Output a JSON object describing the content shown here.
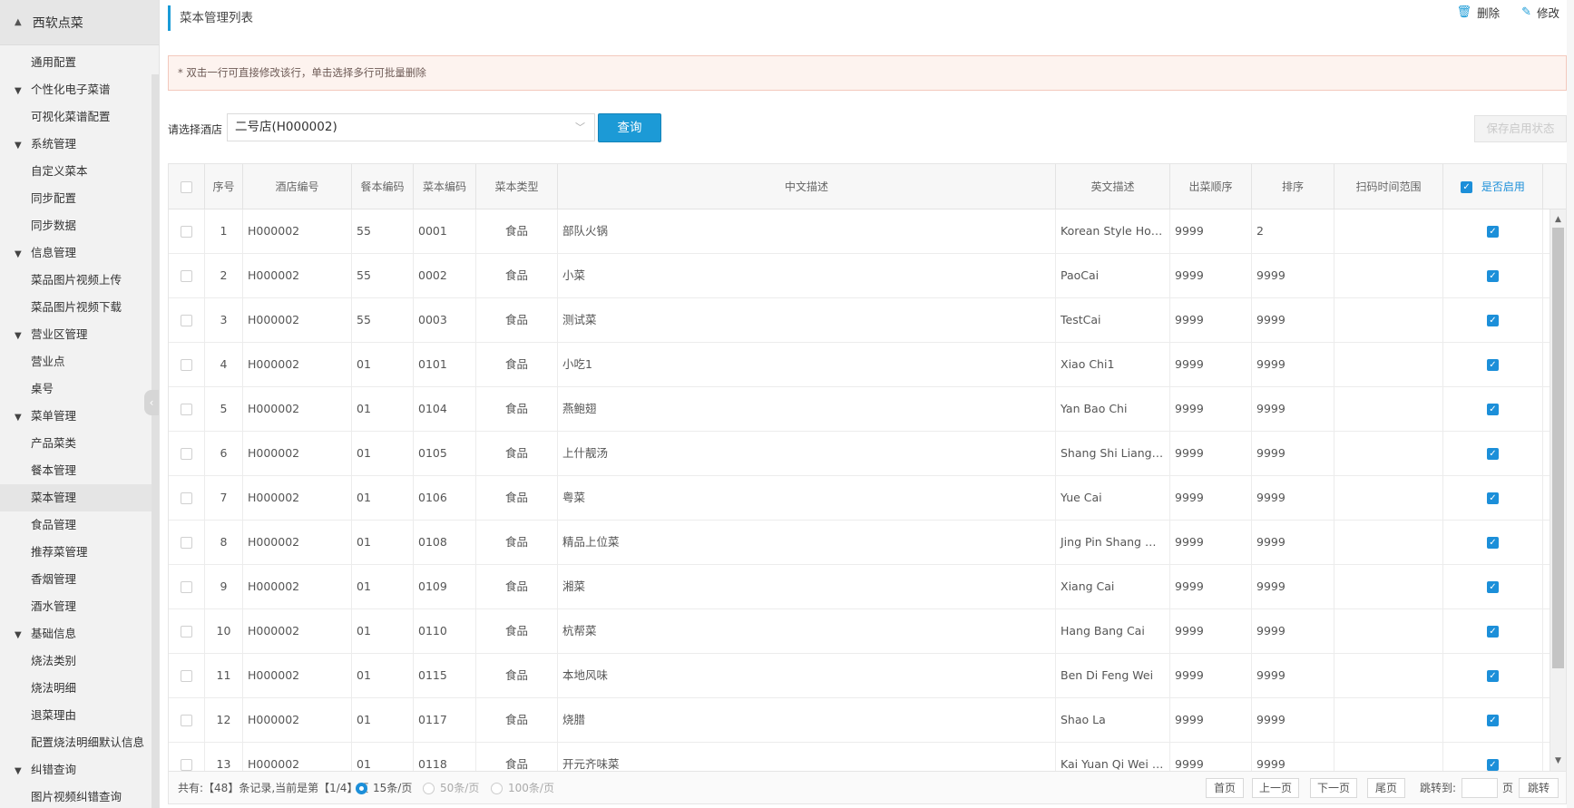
{
  "app": {
    "title": "西软点菜"
  },
  "sidebar": {
    "items": [
      {
        "label": "通用配置",
        "type": "sub"
      },
      {
        "label": "个性化电子菜谱",
        "type": "grp"
      },
      {
        "label": "可视化菜谱配置",
        "type": "sub"
      },
      {
        "label": "系统管理",
        "type": "grp"
      },
      {
        "label": "自定义菜本",
        "type": "sub"
      },
      {
        "label": "同步配置",
        "type": "sub"
      },
      {
        "label": "同步数据",
        "type": "sub"
      },
      {
        "label": "信息管理",
        "type": "grp"
      },
      {
        "label": "菜品图片视频上传",
        "type": "sub"
      },
      {
        "label": "菜品图片视频下载",
        "type": "sub"
      },
      {
        "label": "营业区管理",
        "type": "grp"
      },
      {
        "label": "营业点",
        "type": "sub"
      },
      {
        "label": "桌号",
        "type": "sub"
      },
      {
        "label": "菜单管理",
        "type": "grp"
      },
      {
        "label": "产品菜类",
        "type": "sub"
      },
      {
        "label": "餐本管理",
        "type": "sub"
      },
      {
        "label": "菜本管理",
        "type": "sub",
        "active": true
      },
      {
        "label": "食品管理",
        "type": "sub"
      },
      {
        "label": "推荐菜管理",
        "type": "sub"
      },
      {
        "label": "香烟管理",
        "type": "sub"
      },
      {
        "label": "酒水管理",
        "type": "sub"
      },
      {
        "label": "基础信息",
        "type": "grp"
      },
      {
        "label": "烧法类别",
        "type": "sub"
      },
      {
        "label": "烧法明细",
        "type": "sub"
      },
      {
        "label": "退菜理由",
        "type": "sub"
      },
      {
        "label": "配置烧法明细默认信息",
        "type": "sub"
      },
      {
        "label": "纠错查询",
        "type": "grp"
      },
      {
        "label": "图片视频纠错查询",
        "type": "sub"
      }
    ]
  },
  "header": {
    "title": "菜本管理列表",
    "delete_label": "删除",
    "edit_label": "修改"
  },
  "notice": "* 双击一行可直接修改该行，单击选择多行可批量删除",
  "filter": {
    "label": "请选择酒店",
    "selected": "二号店(H000002)",
    "query_label": "查询",
    "save_label": "保存启用状态"
  },
  "table": {
    "columns": [
      "序号",
      "酒店编号",
      "餐本编码",
      "菜本编码",
      "菜本类型",
      "中文描述",
      "英文描述",
      "出菜顺序",
      "排序",
      "扫码时间范围",
      "是否启用"
    ],
    "rows": [
      [
        "1",
        "H000002",
        "55",
        "0001",
        "食品",
        "部队火锅",
        "Korean Style Hot Pot",
        "9999",
        "2",
        ""
      ],
      [
        "2",
        "H000002",
        "55",
        "0002",
        "食品",
        "小菜",
        "PaoCai",
        "9999",
        "9999",
        ""
      ],
      [
        "3",
        "H000002",
        "55",
        "0003",
        "食品",
        "测试菜",
        "TestCai",
        "9999",
        "9999",
        ""
      ],
      [
        "4",
        "H000002",
        "01",
        "0101",
        "食品",
        "小吃1",
        "Xiao Chi1",
        "9999",
        "9999",
        ""
      ],
      [
        "5",
        "H000002",
        "01",
        "0104",
        "食品",
        "燕鲍翅",
        "Yan Bao Chi",
        "9999",
        "9999",
        ""
      ],
      [
        "6",
        "H000002",
        "01",
        "0105",
        "食品",
        "上什靓汤",
        "Shang Shi Liang Tang",
        "9999",
        "9999",
        ""
      ],
      [
        "7",
        "H000002",
        "01",
        "0106",
        "食品",
        "粤菜",
        "Yue Cai",
        "9999",
        "9999",
        ""
      ],
      [
        "8",
        "H000002",
        "01",
        "0108",
        "食品",
        "精品上位菜",
        "Jing Pin Shang Wei Cai",
        "9999",
        "9999",
        ""
      ],
      [
        "9",
        "H000002",
        "01",
        "0109",
        "食品",
        "湘菜",
        "Xiang Cai",
        "9999",
        "9999",
        ""
      ],
      [
        "10",
        "H000002",
        "01",
        "0110",
        "食品",
        "杭帮菜",
        "Hang Bang Cai",
        "9999",
        "9999",
        ""
      ],
      [
        "11",
        "H000002",
        "01",
        "0115",
        "食品",
        "本地风味",
        "Ben Di Feng Wei",
        "9999",
        "9999",
        ""
      ],
      [
        "12",
        "H000002",
        "01",
        "0117",
        "食品",
        "烧腊",
        "Shao La",
        "9999",
        "9999",
        ""
      ],
      [
        "13",
        "H000002",
        "01",
        "0118",
        "食品",
        "开元齐味菜",
        "Kai Yuan Qi Wei Cai",
        "9999",
        "9999",
        ""
      ]
    ]
  },
  "pager": {
    "info": "共有:【48】条记录,当前是第【1/4】页",
    "size15": "15条/页",
    "size50": "50条/页",
    "size100": "100条/页",
    "first": "首页",
    "prev": "上一页",
    "next": "下一页",
    "last": "尾页",
    "jump_label": "跳转到:",
    "jump_unit": "页",
    "jump_btn": "跳转"
  },
  "colors": {
    "accent": "#1c9ad6",
    "notice_bg": "#fdf3ef"
  }
}
